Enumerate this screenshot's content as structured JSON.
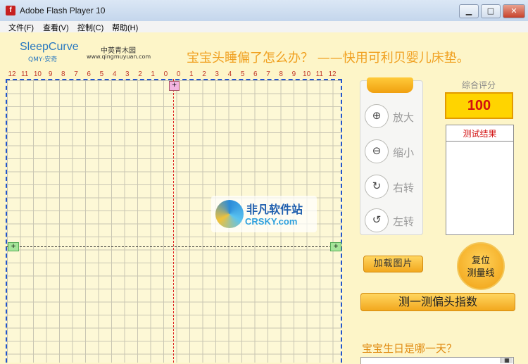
{
  "window": {
    "title": "Adobe Flash Player 10",
    "app_icon": "f",
    "controls": {
      "minimize": "▁",
      "maximize": "□",
      "close": "✕"
    }
  },
  "menu": [
    {
      "label": "文件(F)"
    },
    {
      "label": "查看(V)"
    },
    {
      "label": "控制(C)"
    },
    {
      "label": "帮助(H)"
    }
  ],
  "logo": {
    "main": "SleepCurve",
    "sub": "QMY·安奇"
  },
  "brand": {
    "name_cn": "中英青木园",
    "url": "www.qingmuyuan.com"
  },
  "headline": "宝宝头睡偏了怎么办？ ——快用可利贝婴儿床垫。",
  "ruler": [
    "12",
    "11",
    "10",
    "9",
    "8",
    "7",
    "6",
    "5",
    "4",
    "3",
    "2",
    "1",
    "0",
    "0",
    "1",
    "2",
    "3",
    "4",
    "5",
    "6",
    "7",
    "8",
    "9",
    "10",
    "11",
    "12"
  ],
  "handles": {
    "top": "+",
    "left": "+",
    "right": "+"
  },
  "watermark": {
    "cn": "非凡软件站",
    "en": "CRSKY.com"
  },
  "tools": [
    {
      "icon": "zoom-in-icon",
      "glyph": "⊕",
      "label": "放大"
    },
    {
      "icon": "zoom-out-icon",
      "glyph": "⊖",
      "label": "缩小"
    },
    {
      "icon": "rotate-right-icon",
      "glyph": "↻",
      "label": "右转"
    },
    {
      "icon": "rotate-left-icon",
      "glyph": "↺",
      "label": "左转"
    }
  ],
  "score": {
    "label": "综合评分",
    "value": "100"
  },
  "result": {
    "title": "测试结果"
  },
  "buttons": {
    "load": "加载图片",
    "reset_line1": "复位",
    "reset_line2": "测量线",
    "measure": "测一测偏头指数"
  },
  "birthday": {
    "label": "宝宝生日是哪一天？",
    "value": "",
    "picker": "▦"
  },
  "colors": {
    "accent": "#f0a020",
    "grid_border": "#2255cc",
    "score_text": "#d21010",
    "bg": "#fdf5c8"
  }
}
